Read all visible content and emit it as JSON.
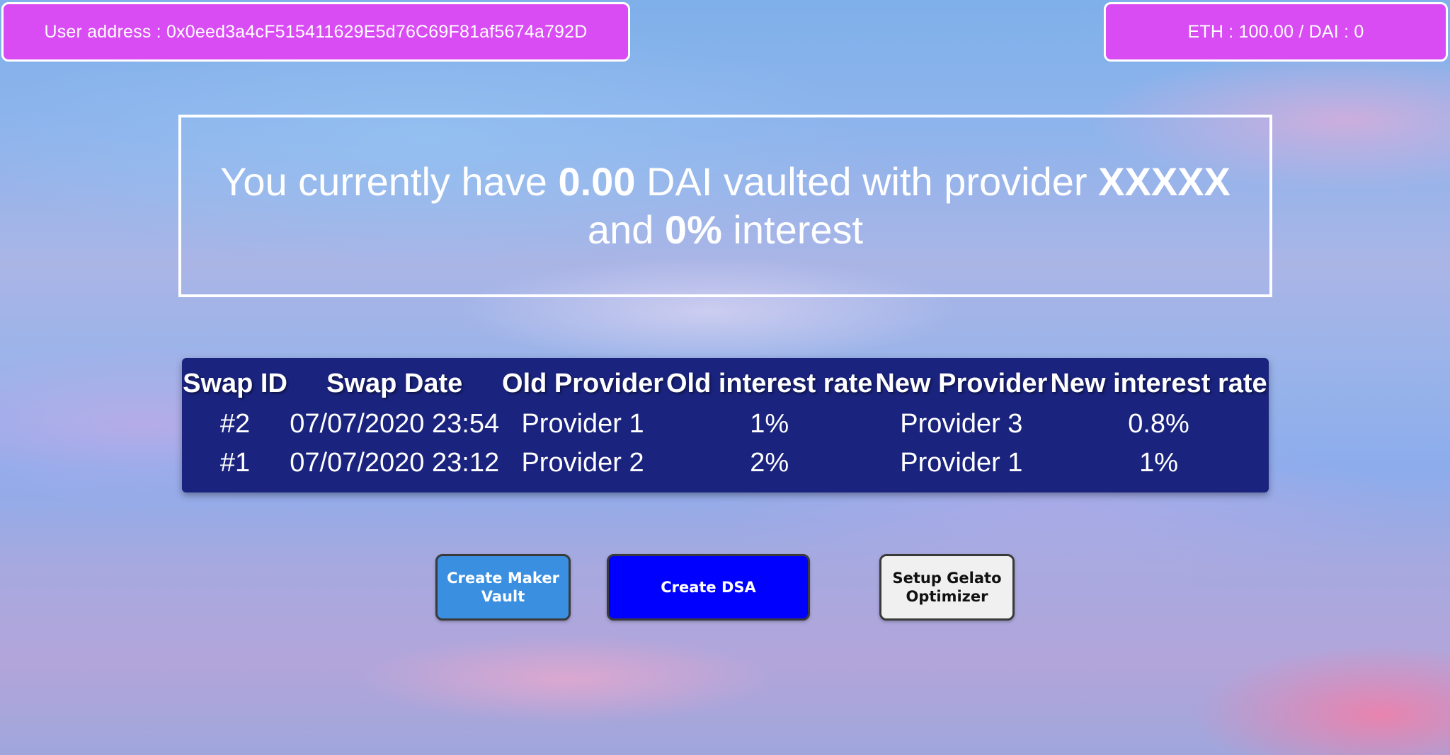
{
  "header": {
    "user_address": "User address : 0x0eed3a4cF515411629E5d76C69F81af5674a792D",
    "balances": "ETH : 100.00 / DAI : 0"
  },
  "summary": {
    "prefix": "You currently have",
    "amount": "0.00",
    "middle": "DAI vaulted with provider",
    "provider": "XXXXX",
    "and": "and",
    "interest": "0%",
    "suffix": "interest"
  },
  "swap_table": {
    "headers": [
      "Swap ID",
      "Swap Date",
      "Old Provider",
      "Old interest rate",
      "New Provider",
      "New interest rate"
    ],
    "rows": [
      [
        "#2",
        "07/07/2020 23:54",
        "Provider 1",
        "1%",
        "Provider 3",
        "0.8%"
      ],
      [
        "#1",
        "07/07/2020 23:12",
        "Provider 2",
        "2%",
        "Provider 1",
        "1%"
      ]
    ]
  },
  "buttons": {
    "create_maker_vault": "Create Maker Vault",
    "create_dsa": "Create DSA",
    "setup_gelato_optimizer": "Setup Gelato Optimizer"
  },
  "colors": {
    "top_bar": "#d94cf4",
    "table_bg": "#1a237e",
    "maker_button": "#3a8fe0",
    "dsa_button": "#0000ff",
    "gelato_button": "#f0f0f0"
  }
}
